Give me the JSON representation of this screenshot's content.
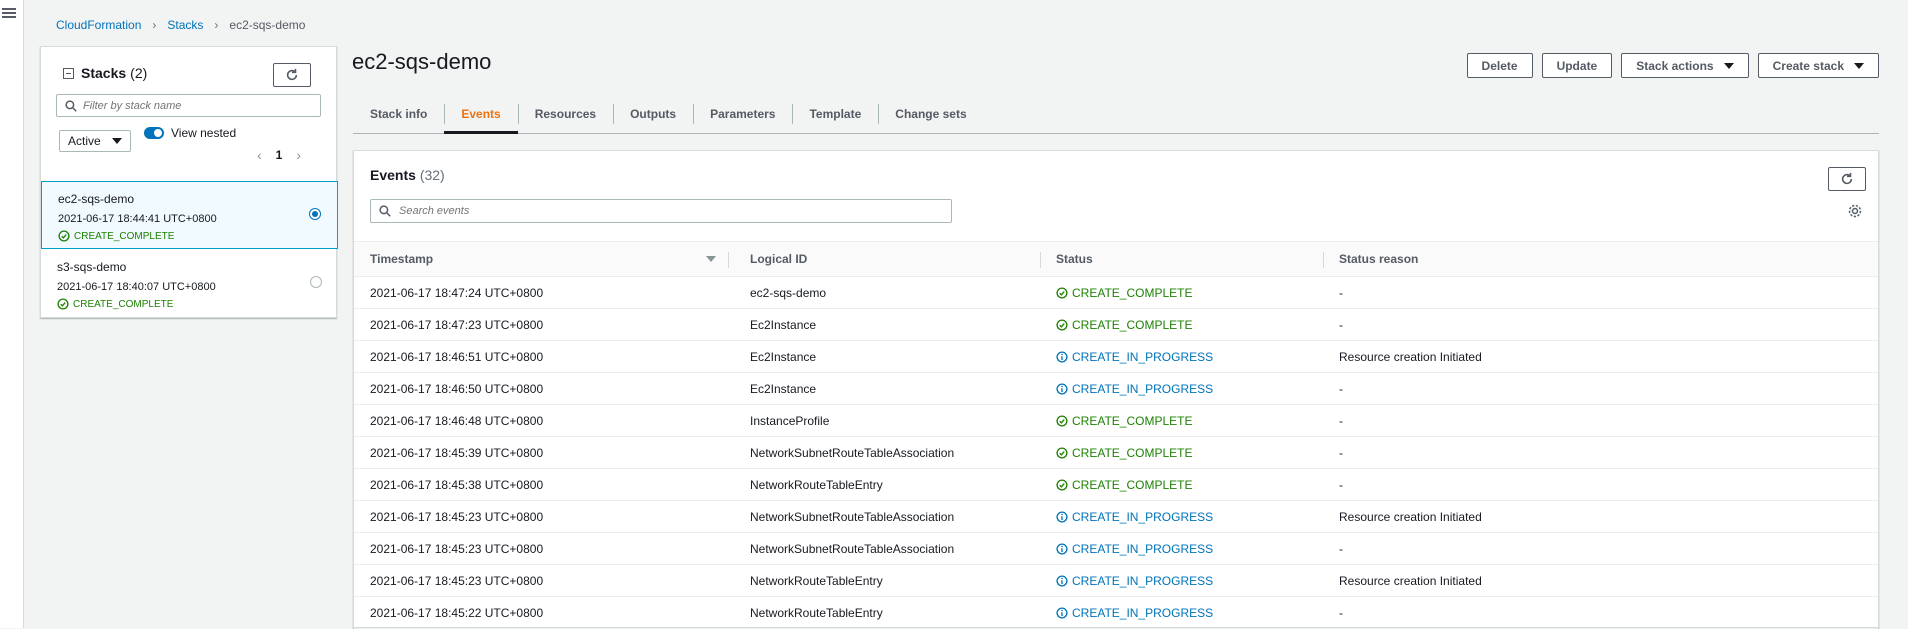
{
  "breadcrumb": [
    "CloudFormation",
    "Stacks",
    "ec2-sqs-demo"
  ],
  "stacks_panel": {
    "title": "Stacks",
    "count": "(2)",
    "filter_placeholder": "Filter by stack name",
    "status_filter": "Active",
    "view_nested_label": "View nested",
    "page": "1",
    "items": [
      {
        "name": "ec2-sqs-demo",
        "timestamp": "2021-06-17 18:44:41 UTC+0800",
        "status": "CREATE_COMPLETE",
        "selected": true
      },
      {
        "name": "s3-sqs-demo",
        "timestamp": "2021-06-17 18:40:07 UTC+0800",
        "status": "CREATE_COMPLETE",
        "selected": false
      }
    ]
  },
  "header": {
    "title": "ec2-sqs-demo",
    "buttons": {
      "delete": "Delete",
      "update": "Update",
      "stack_actions": "Stack actions",
      "create_stack": "Create stack"
    }
  },
  "tabs": [
    "Stack info",
    "Events",
    "Resources",
    "Outputs",
    "Parameters",
    "Template",
    "Change sets"
  ],
  "active_tab": "Events",
  "events": {
    "title": "Events",
    "count": "(32)",
    "search_placeholder": "Search events",
    "columns": [
      "Timestamp",
      "Logical ID",
      "Status",
      "Status reason"
    ],
    "rows": [
      {
        "timestamp": "2021-06-17 18:47:24 UTC+0800",
        "logical_id": "ec2-sqs-demo",
        "status": "CREATE_COMPLETE",
        "reason": "-"
      },
      {
        "timestamp": "2021-06-17 18:47:23 UTC+0800",
        "logical_id": "Ec2Instance",
        "status": "CREATE_COMPLETE",
        "reason": "-"
      },
      {
        "timestamp": "2021-06-17 18:46:51 UTC+0800",
        "logical_id": "Ec2Instance",
        "status": "CREATE_IN_PROGRESS",
        "reason": "Resource creation Initiated"
      },
      {
        "timestamp": "2021-06-17 18:46:50 UTC+0800",
        "logical_id": "Ec2Instance",
        "status": "CREATE_IN_PROGRESS",
        "reason": "-"
      },
      {
        "timestamp": "2021-06-17 18:46:48 UTC+0800",
        "logical_id": "InstanceProfile",
        "status": "CREATE_COMPLETE",
        "reason": "-"
      },
      {
        "timestamp": "2021-06-17 18:45:39 UTC+0800",
        "logical_id": "NetworkSubnetRouteTableAssociation",
        "status": "CREATE_COMPLETE",
        "reason": "-"
      },
      {
        "timestamp": "2021-06-17 18:45:38 UTC+0800",
        "logical_id": "NetworkRouteTableEntry",
        "status": "CREATE_COMPLETE",
        "reason": "-"
      },
      {
        "timestamp": "2021-06-17 18:45:23 UTC+0800",
        "logical_id": "NetworkSubnetRouteTableAssociation",
        "status": "CREATE_IN_PROGRESS",
        "reason": "Resource creation Initiated"
      },
      {
        "timestamp": "2021-06-17 18:45:23 UTC+0800",
        "logical_id": "NetworkSubnetRouteTableAssociation",
        "status": "CREATE_IN_PROGRESS",
        "reason": "-"
      },
      {
        "timestamp": "2021-06-17 18:45:23 UTC+0800",
        "logical_id": "NetworkRouteTableEntry",
        "status": "CREATE_IN_PROGRESS",
        "reason": "Resource creation Initiated"
      },
      {
        "timestamp": "2021-06-17 18:45:22 UTC+0800",
        "logical_id": "NetworkRouteTableEntry",
        "status": "CREATE_IN_PROGRESS",
        "reason": "-"
      }
    ]
  },
  "colors": {
    "link": "#0073bb",
    "success": "#1d8102",
    "in_progress": "#0073bb",
    "active_tab": "#ec7211"
  },
  "icons": [
    "menu-icon",
    "chevron-right-icon",
    "refresh-icon",
    "search-icon",
    "caret-down-icon",
    "check-circle-icon",
    "info-circle-icon",
    "gear-icon"
  ]
}
